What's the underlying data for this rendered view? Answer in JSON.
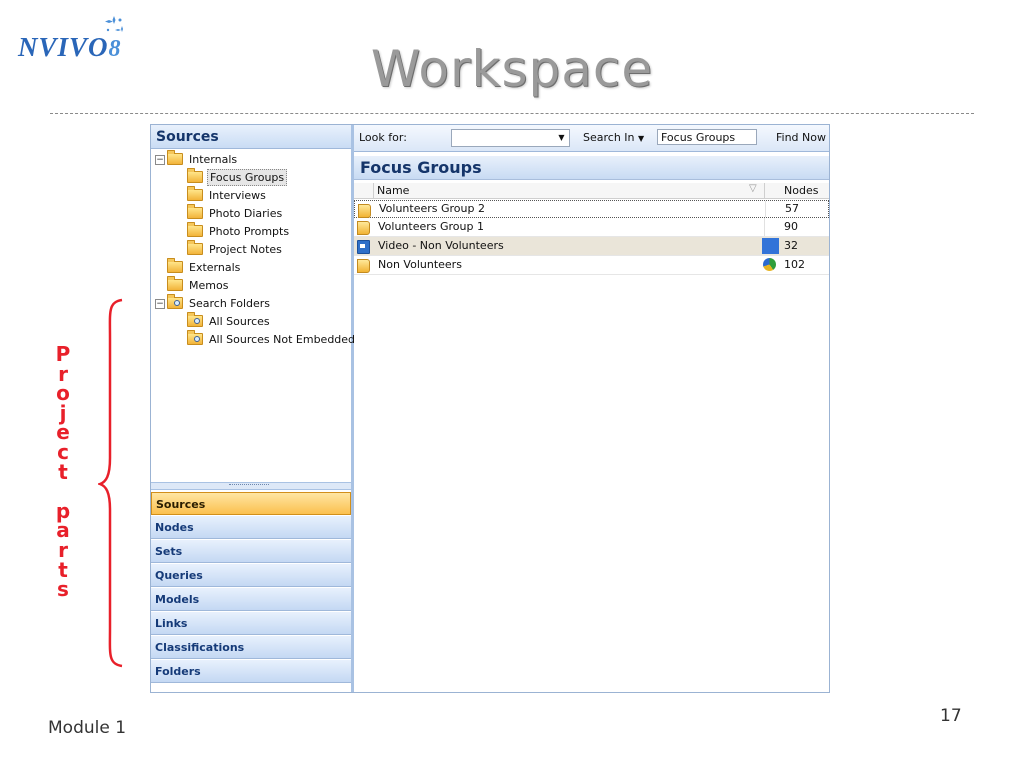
{
  "slide": {
    "logo": {
      "text": "NVIVO",
      "version": "8"
    },
    "title": "Workspace",
    "footer": "Module 1",
    "page_number": "17",
    "annotation_letters": [
      "P",
      "r",
      "o",
      "j",
      "e",
      "c",
      "t",
      "",
      "p",
      "a",
      "r",
      "t",
      "s"
    ],
    "accent_color": "#e8202a"
  },
  "app": {
    "nav": {
      "header": "Sources",
      "tree": [
        {
          "label": "Internals",
          "icon": "folder-open-icon",
          "expander": "−"
        },
        {
          "label": "Focus Groups",
          "icon": "folder-open-icon",
          "selected": true
        },
        {
          "label": "Interviews",
          "icon": "folder-icon"
        },
        {
          "label": "Photo Diaries",
          "icon": "folder-icon"
        },
        {
          "label": "Photo Prompts",
          "icon": "folder-icon"
        },
        {
          "label": "Project Notes",
          "icon": "folder-icon"
        },
        {
          "label": "Externals",
          "icon": "externals-folder-icon"
        },
        {
          "label": "Memos",
          "icon": "memos-folder-icon"
        },
        {
          "label": "Search Folders",
          "icon": "search-folder-icon",
          "expander": "−"
        },
        {
          "label": "All Sources",
          "icon": "search-folder-icon"
        },
        {
          "label": "All Sources Not Embedded",
          "icon": "search-folder-icon"
        }
      ],
      "buttons": [
        "Sources",
        "Nodes",
        "Sets",
        "Queries",
        "Models",
        "Links",
        "Classifications",
        "Folders"
      ],
      "active_button": "Sources"
    },
    "find": {
      "look_for_label": "Look for:",
      "look_for_value": "",
      "search_in_label": "Search In",
      "search_in_value": "Focus Groups",
      "find_now_label": "Find Now"
    },
    "list": {
      "title": "Focus Groups",
      "columns": [
        "Name",
        "Nodes"
      ],
      "rows": [
        {
          "name": "Volunteers Group 2",
          "nodes": "57",
          "icon": "document-icon"
        },
        {
          "name": "Volunteers Group 1",
          "nodes": "90",
          "icon": "document-icon"
        },
        {
          "name": "Video - Non Volunteers",
          "nodes": "32",
          "icon": "video-icon",
          "color": "#3273d8"
        },
        {
          "name": "Non Volunteers",
          "nodes": "102",
          "icon": "document-icon",
          "attribute_icon": "classification-icon"
        }
      ]
    }
  }
}
